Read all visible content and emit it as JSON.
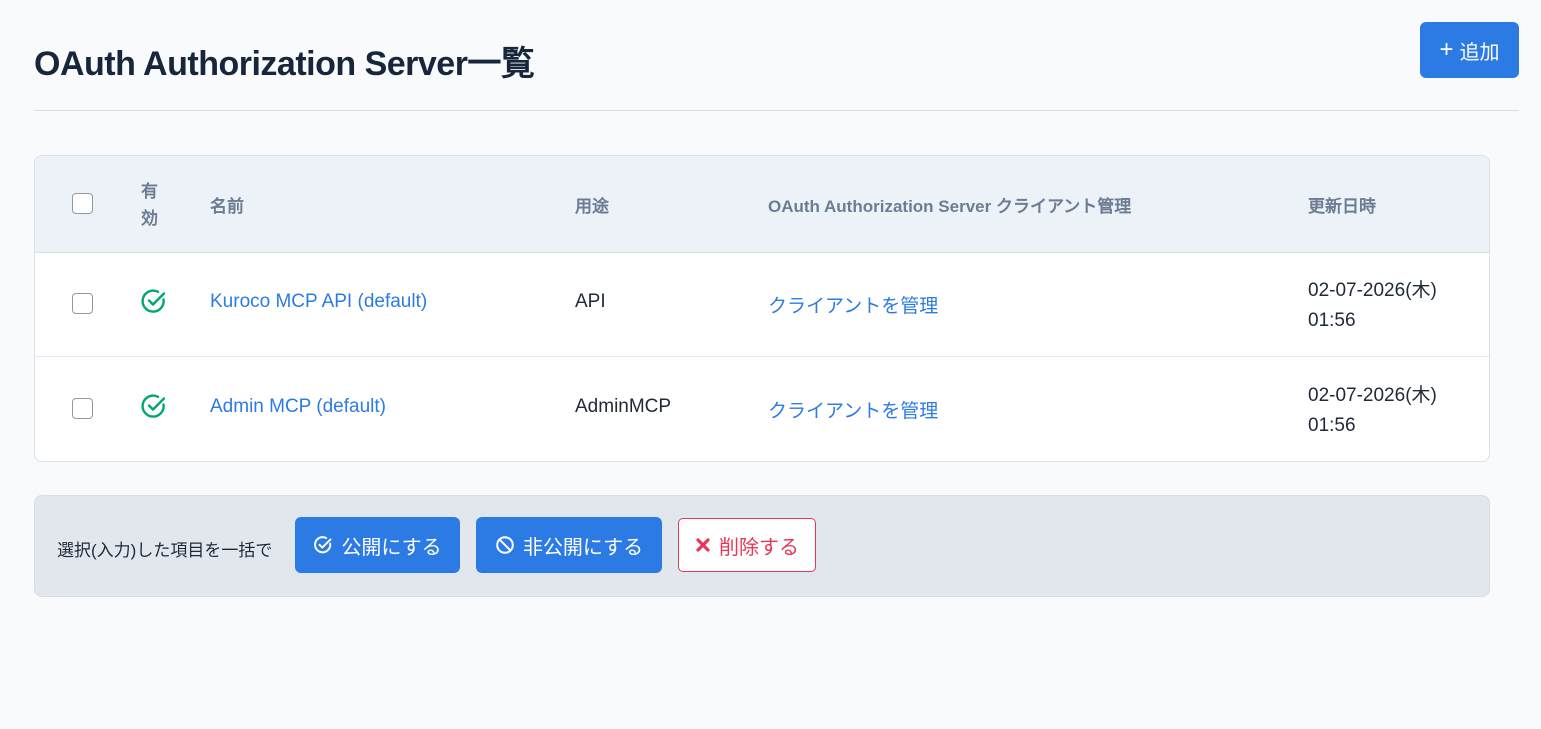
{
  "header": {
    "title": "OAuth Authorization Server一覧",
    "add_button_label": "追加",
    "add_icon": "plus-icon"
  },
  "table": {
    "columns": {
      "enabled_line1": "有",
      "enabled_line2": "効",
      "name": "名前",
      "purpose": "用途",
      "client": "OAuth Authorization Server クライアント管理",
      "updated": "更新日時"
    },
    "rows": [
      {
        "enabled": true,
        "name": "Kuroco MCP API (default)",
        "purpose": "API",
        "client_link": "クライアントを管理",
        "updated_date": "02-07-2026(木)",
        "updated_time": "01:56"
      },
      {
        "enabled": true,
        "name": "Admin MCP (default)",
        "purpose": "AdminMCP",
        "client_link": "クライアントを管理",
        "updated_date": "02-07-2026(木)",
        "updated_time": "01:56"
      }
    ]
  },
  "bulk": {
    "label": "選択(入力)した項目を一括で",
    "publish_label": "公開にする",
    "unpublish_label": "非公開にする",
    "delete_label": "削除する"
  },
  "colors": {
    "primary": "#2c7be5",
    "success": "#00a86b",
    "danger": "#e63757",
    "title": "#17263b"
  }
}
